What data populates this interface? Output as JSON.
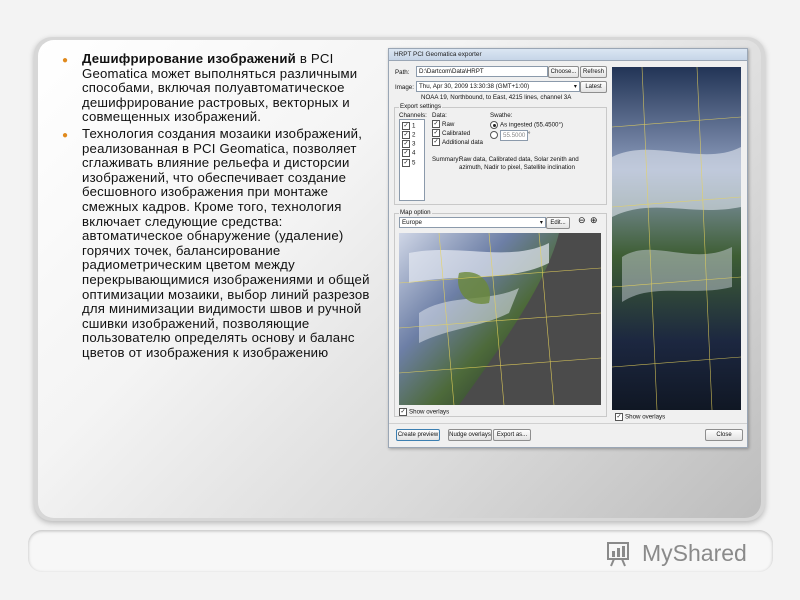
{
  "slide": {
    "bullets": [
      {
        "bold": "Дешифрирование изображений",
        "text": " в PCI Geomatica может выполняться различными способами, включая полуавтоматическое дешифрирование растровых, векторных и совмещенных изображений."
      },
      {
        "bold": "",
        "text": "Технология создания мозаики изображений, реализованная в PCI Geomatica, позволяет сглаживать влияние рельефа и дисторсии изображений, что обеспечивает создание бесшовного изображения при монтаже смежных кадров. Кроме того, технология включает следующие средства: автоматическое обнаружение (удаление) горячих точек, балансирование радиометрическим цветом между перекрывающимися изображениями и общей оптимизации мозаики, выбор линий разрезов для минимизации видимости швов и ручной сшивки изображений, позволяющие пользователю определять основу и баланс цветов от изображения к изображению"
      }
    ],
    "colors": {
      "bullet": "#e08a1e",
      "card": "#d9d9d9"
    }
  },
  "dialog": {
    "title": "HRPT PCI Geomatica exporter",
    "path_label": "Path:",
    "path_value": "D:\\Dartcom\\Data\\HRPT",
    "choose_button": "Choose...",
    "refresh_button": "Refresh",
    "image_label": "Image:",
    "image_value": "Thu, Apr 30, 2009        13:30:38 (GMT+1:00)",
    "latest_button": "Latest",
    "image_info": "NOAA 19, Northbound, to East, 4215 lines, channel 3A",
    "export_settings": "Export settings",
    "channels_label": "Channels:",
    "channels": [
      "1",
      "2",
      "3",
      "4",
      "5"
    ],
    "data_label": "Data:",
    "data_options": [
      "Raw",
      "Calibrated",
      "Additional data"
    ],
    "swathe_label": "Swathe:",
    "swathe_option1": "As ingested (55.4500°)",
    "swathe_value": "55.5000",
    "swathe_unit": "°",
    "summary_label": "Summary:",
    "summary_text": "Raw data, Calibrated data, Solar zenith and azimuth, Nadir to pixel, Satellite inclination",
    "map_option": "Map option",
    "map_value": "Europe",
    "edit_button": "Edit...",
    "zoom_out_icon": "zoom-out-icon",
    "zoom_in_icon": "zoom-in-icon",
    "show_overlays": "Show overlays",
    "show_overlays_right": "Show overlays",
    "create_preview": "Create preview",
    "nudge_overlays": "Nudge overlays",
    "export_as": "Export as...",
    "close": "Close"
  },
  "watermark": {
    "text": "MyShared"
  }
}
